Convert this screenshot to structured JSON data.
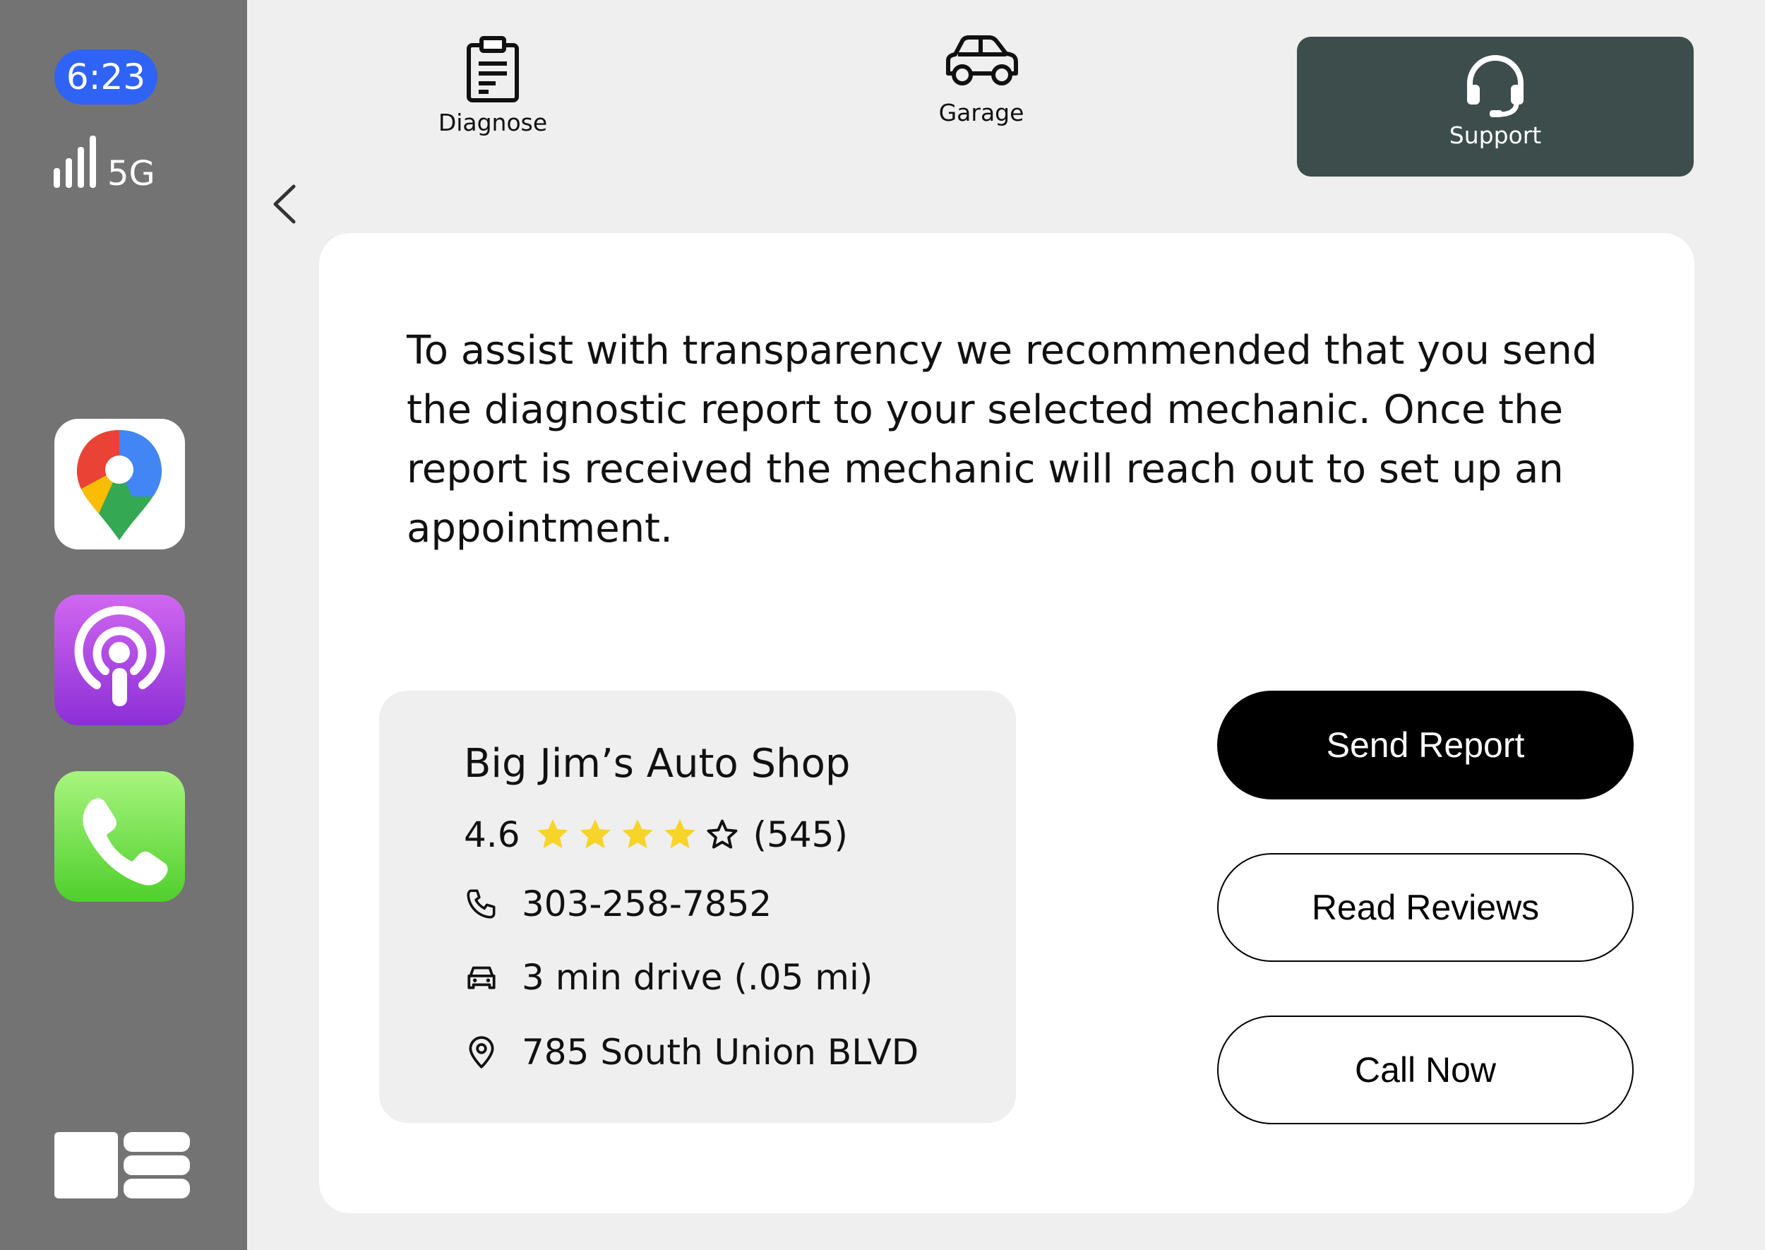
{
  "status": {
    "time": "6:23",
    "network": "5G"
  },
  "sidebar": {
    "apps": [
      {
        "name": "maps",
        "icon": "google-maps-icon"
      },
      {
        "name": "podcasts",
        "icon": "podcasts-icon"
      },
      {
        "name": "phone",
        "icon": "phone-icon"
      }
    ],
    "dashboard_icon": "dashboard-icon"
  },
  "nav": {
    "diagnose": "Diagnose",
    "garage": "Garage",
    "support": "Support",
    "active": "support"
  },
  "main": {
    "message": "To assist with transparency we recommended that you send the diagnostic report to your selected mechanic. Once the report is received the mechanic will reach out to set up an appointment."
  },
  "shop": {
    "name": "Big Jim’s Auto Shop",
    "rating": "4.6",
    "stars_filled": 4,
    "stars_total": 5,
    "review_count": "(545)",
    "phone": "303-258-7852",
    "drive": "3 min drive (.05 mi)",
    "address": "785 South Union BLVD"
  },
  "actions": {
    "send_report": "Send Report",
    "read_reviews": "Read Reviews",
    "call_now": "Call Now"
  },
  "colors": {
    "sidebar": "#737373",
    "clock_badge": "#2f63f5",
    "support_active": "#3d4d4b",
    "star": "#f7d42a"
  }
}
